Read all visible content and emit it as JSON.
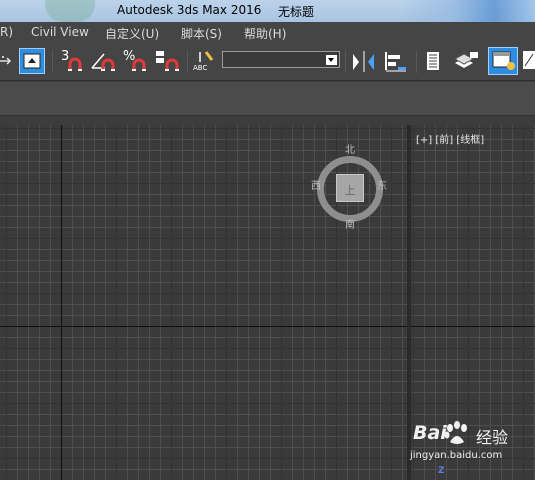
{
  "window": {
    "app_title": "Autodesk 3ds Max 2016",
    "doc_title": "无标题"
  },
  "menu": [
    {
      "label": "R)"
    },
    {
      "label": "Civil View"
    },
    {
      "label": "自定义(U)"
    },
    {
      "label": "脚本(S)"
    },
    {
      "label": "帮助(H)"
    }
  ],
  "toolbar": {
    "snap3": "3",
    "angle_snap": "%",
    "named_selection_value": "",
    "abc_label": "ABC"
  },
  "viewport": {
    "label": "[+] [前] [线框]",
    "viewcube": {
      "face": "上",
      "north": "北",
      "south": "南",
      "east": "东",
      "west": "西"
    }
  },
  "watermark": {
    "brand": "Bai",
    "brand_zh": "经验",
    "url": "jingyan.baidu.com",
    "axis": "Z"
  },
  "colors": {
    "background": "#3d3d3d",
    "grid_minor": "#4f4f4f",
    "grid_major": "#333333",
    "accent_active": "#2f8de0"
  }
}
